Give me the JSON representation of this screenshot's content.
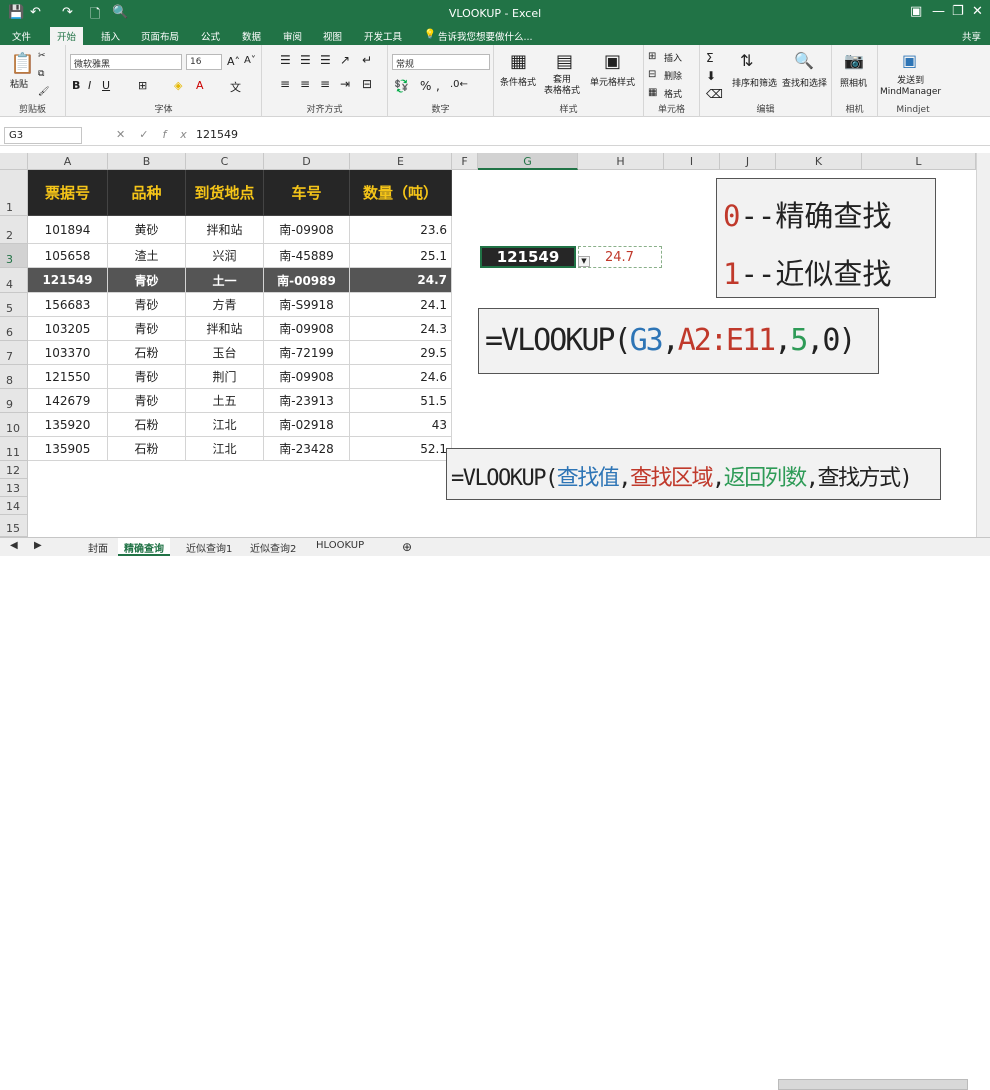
{
  "window": {
    "title": "VLOOKUP - Excel"
  },
  "quick_access": {
    "save": "💾",
    "undo": "↶",
    "redo": "↷",
    "new": "🗋",
    "preview": "🔍"
  },
  "window_controls": {
    "ribbon_opts": "▣",
    "minimize": "—",
    "restore": "❐",
    "close": "✕"
  },
  "menu_tabs": [
    "文件",
    "开始",
    "插入",
    "页面布局",
    "公式",
    "数据",
    "审阅",
    "视图",
    "开发工具"
  ],
  "active_tab": "开始",
  "tell_me": "告诉我您想要做什么...",
  "share": "共享",
  "ribbon": {
    "paste": "粘贴",
    "clipboard": "剪贴板",
    "font_name": "微软雅黑",
    "font_size": "16",
    "font": "字体",
    "alignment": "对齐方式",
    "number_format": "常规",
    "number": "数字",
    "cond_format": "条件格式",
    "table_format": "套用\n表格格式",
    "cell_style": "单元格样式",
    "styles": "样式",
    "insert": "插入",
    "delete": "删除",
    "format": "格式",
    "cells": "单元格",
    "sort_filter": "排序和筛选",
    "find_select": "查找和选择",
    "editing": "编辑",
    "camera": "照相机",
    "camera_group": "相机",
    "mindjet_send": "发送到\nMindManager",
    "mindjet": "Mindjet"
  },
  "formula_bar": {
    "name_box": "G3",
    "fx": "fx",
    "value": "121549"
  },
  "columns": [
    "A",
    "B",
    "C",
    "D",
    "E",
    "F",
    "G",
    "H",
    "I",
    "J",
    "K",
    "L"
  ],
  "rows": [
    "1",
    "2",
    "3",
    "4",
    "5",
    "6",
    "7",
    "8",
    "9",
    "10",
    "11",
    "12",
    "13",
    "14",
    "15"
  ],
  "table": {
    "headers": [
      "票据号",
      "品种",
      "到货地点",
      "车号",
      "数量（吨）"
    ],
    "rows": [
      [
        "101894",
        "黄砂",
        "拌和站",
        "南-09908",
        "23.6"
      ],
      [
        "105658",
        "渣土",
        "兴润",
        "南-45889",
        "25.1"
      ],
      [
        "121549",
        "青砂",
        "土一",
        "南-00989",
        "24.7"
      ],
      [
        "156683",
        "青砂",
        "方青",
        "南-S9918",
        "24.1"
      ],
      [
        "103205",
        "青砂",
        "拌和站",
        "南-09908",
        "24.3"
      ],
      [
        "103370",
        "石粉",
        "玉台",
        "南-72199",
        "29.5"
      ],
      [
        "121550",
        "青砂",
        "荆门",
        "南-09908",
        "24.6"
      ],
      [
        "142679",
        "青砂",
        "土五",
        "南-23913",
        "51.5"
      ],
      [
        "135920",
        "石粉",
        "江北",
        "南-02918",
        "43"
      ],
      [
        "135905",
        "石粉",
        "江北",
        "南-23428",
        "52.1"
      ]
    ]
  },
  "lookup": {
    "g3": "121549",
    "h3": "24.7"
  },
  "legend": {
    "line1_num": "0",
    "line1_text": "--精确查找",
    "line2_num": "1",
    "line2_text": "--近似查找"
  },
  "formula_example": {
    "p1": "=VLOOKUP(",
    "p2": "G3",
    "p3": ",",
    "p4": "A2:E11",
    "p5": ",",
    "p6": "5",
    "p7": ",",
    "p8": "0",
    "p9": ")"
  },
  "syntax": {
    "p1": "=VLOOKUP(",
    "p2": "查找值",
    "p3": ",",
    "p4": "查找区域",
    "p5": ",",
    "p6": "返回列数",
    "p7": ",",
    "p8": "查找方式",
    "p9": ")"
  },
  "sheets": [
    "封面",
    "精确查询",
    "近似查询1",
    "近似查询2",
    "HLOOKUP"
  ],
  "active_sheet": "精确查询",
  "colors": {
    "excel_green": "#217346",
    "header_gold": "#f5c518",
    "blue": "#2e75b6",
    "red": "#c0392b",
    "green": "#2e9b57"
  }
}
